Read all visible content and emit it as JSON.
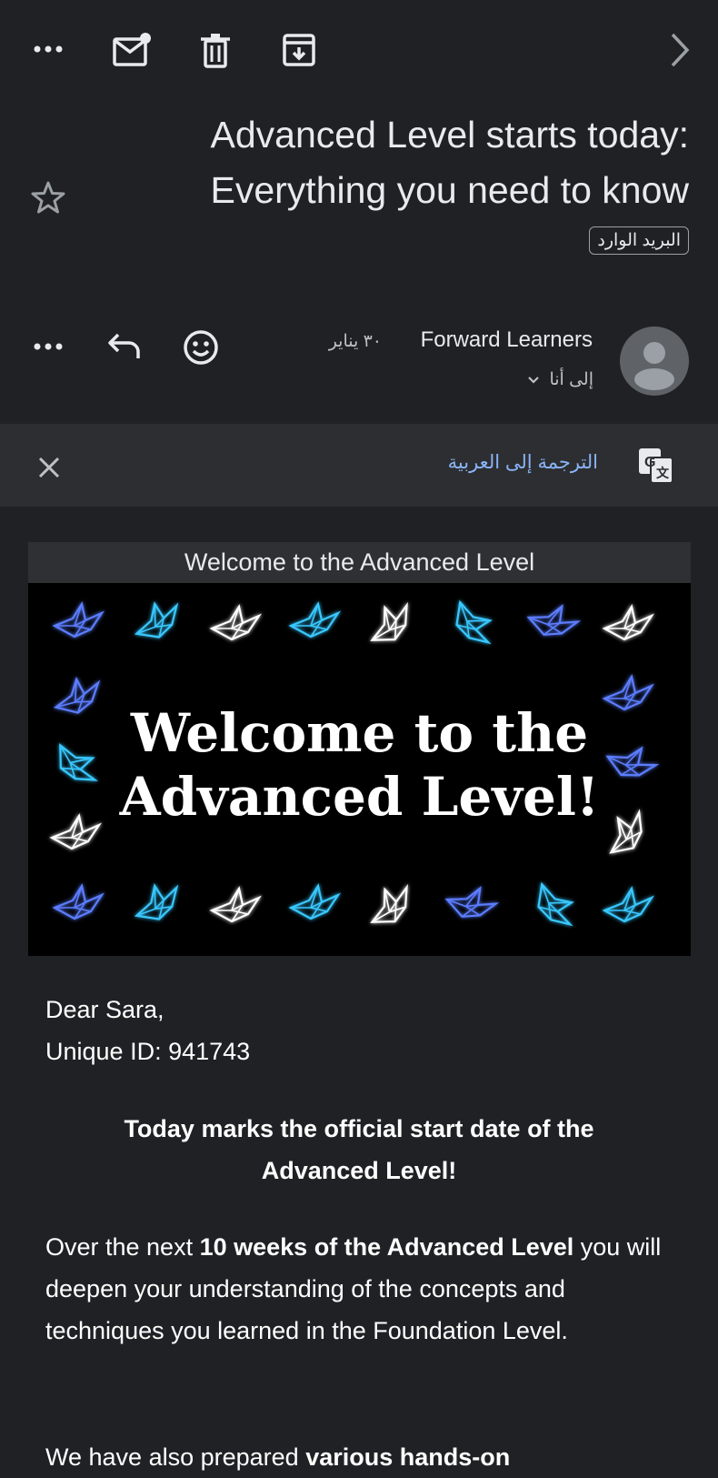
{
  "toolbar": {
    "icons": [
      "more-horizontal-icon",
      "mark-unread-icon",
      "delete-icon",
      "archive-icon",
      "chevron-right-icon"
    ]
  },
  "email": {
    "subject_line1": "Advanced Level starts today:",
    "subject_line2": "Everything you need to know",
    "label": "البريد الوارد",
    "sender_name": "Forward Learners",
    "date": "٣٠ يناير",
    "recipient": "إلى أنا"
  },
  "translate": {
    "link": "الترجمة إلى العربية"
  },
  "banner": {
    "title": "Welcome to the Advanced Level",
    "image_line1": "Welcome to the",
    "image_line2": "Advanced Level!"
  },
  "body": {
    "greeting": "Dear Sara,",
    "unique_id": "Unique ID: 941743",
    "headline": "Today marks the official start date of the Advanced Level!",
    "para1_a": "Over the next ",
    "para1_b": "10 weeks of the Advanced Level",
    "para1_c": " you will deepen your understanding of the concepts and techniques you learned in the Foundation Level.",
    "para2_a": "We have also prepared ",
    "para2_b": "various hands-on"
  },
  "colors": {
    "background": "#202124",
    "translate_bar": "#2d2e31",
    "link": "#8ab4f8",
    "bird_blue": "#5b7dff",
    "bird_cyan": "#38c8ff",
    "bird_white": "#ffffff"
  }
}
